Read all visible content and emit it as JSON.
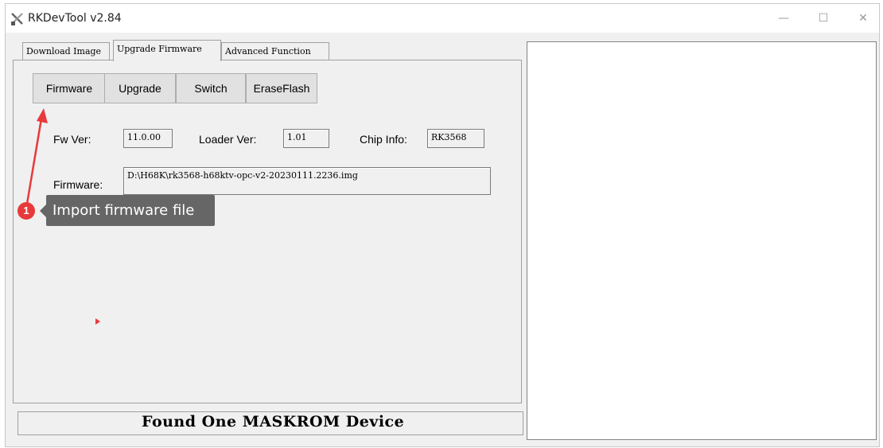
{
  "window": {
    "title": "RKDevTool v2.84",
    "controls": {
      "minimize": "—",
      "maximize": "☐",
      "close": "✕"
    }
  },
  "tabs": [
    {
      "label": "Download Image"
    },
    {
      "label": "Upgrade Firmware"
    },
    {
      "label": "Advanced Function"
    }
  ],
  "toolbar": {
    "firmware_label": "Firmware",
    "upgrade_label": "Upgrade",
    "switch_label": "Switch",
    "eraseflash_label": "EraseFlash"
  },
  "info": {
    "fw_ver_label": "Fw Ver:",
    "fw_ver_value": "11.0.00",
    "loader_ver_label": "Loader Ver:",
    "loader_ver_value": "1.01",
    "chip_info_label": "Chip Info:",
    "chip_info_value": "RK3568",
    "firmware_label": "Firmware:",
    "firmware_value": "D:\\H68K\\rk3568-h68ktv-opc-v2-20230111.2236.img"
  },
  "annotation": {
    "step_number": "1",
    "text": "Import firmware file",
    "color": "#e83a3a"
  },
  "status": {
    "text": "Found One MASKROM Device"
  }
}
